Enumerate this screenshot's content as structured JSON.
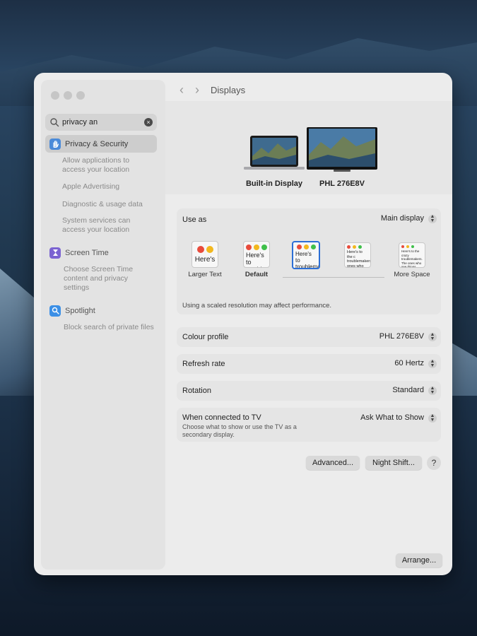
{
  "window": {
    "title": "Displays"
  },
  "search": {
    "value": "privacy an"
  },
  "sidebar": {
    "items": [
      {
        "label": "Privacy & Security",
        "selected": true,
        "icon": "hand-icon",
        "color": "#4a8ad9",
        "subs": [
          "Allow applications to access your location",
          "Apple Advertising",
          "Diagnostic & usage data",
          "System services can access your location"
        ]
      },
      {
        "label": "Screen Time",
        "icon": "hourglass-icon",
        "color": "#7b63d1",
        "subs": [
          "Choose Screen Time content and privacy settings"
        ]
      },
      {
        "label": "Spotlight",
        "icon": "magnifier-icon",
        "color": "#3b8fe6",
        "subs": [
          "Block search of private files"
        ]
      }
    ]
  },
  "displays": {
    "builtin": {
      "label": "Built-in Display"
    },
    "external": {
      "label": "PHL 276E8V",
      "selected": true
    }
  },
  "use_as": {
    "label": "Use as",
    "value": "Main display"
  },
  "resolution": {
    "options": [
      {
        "text": "Here's",
        "caption": "Larger Text"
      },
      {
        "text": "Here's to troublem",
        "caption": "Default"
      },
      {
        "text": "Here's to troublema ones who",
        "caption": "",
        "selected": true
      },
      {
        "text": "Here's to the c troublemakers. ones who see t rules. And they",
        "caption": ""
      },
      {
        "text": "Here's to the crazy troublemakers. The ones who see things rules. And they have no",
        "caption": "More Space"
      }
    ],
    "note": "Using a scaled resolution may affect performance."
  },
  "colour_profile": {
    "label": "Colour profile",
    "value": "PHL 276E8V"
  },
  "refresh_rate": {
    "label": "Refresh rate",
    "value": "60 Hertz"
  },
  "rotation": {
    "label": "Rotation",
    "value": "Standard"
  },
  "tv": {
    "label": "When connected to TV",
    "value": "Ask What to Show",
    "description": "Choose what to show or use the TV as a secondary display."
  },
  "buttons": {
    "advanced": "Advanced...",
    "night_shift": "Night Shift...",
    "help": "?",
    "arrange": "Arrange..."
  },
  "colors": {
    "red": "#e84b3c",
    "yellow": "#f2b81f",
    "green": "#3fc04a",
    "accent": "#2c6fd6"
  }
}
